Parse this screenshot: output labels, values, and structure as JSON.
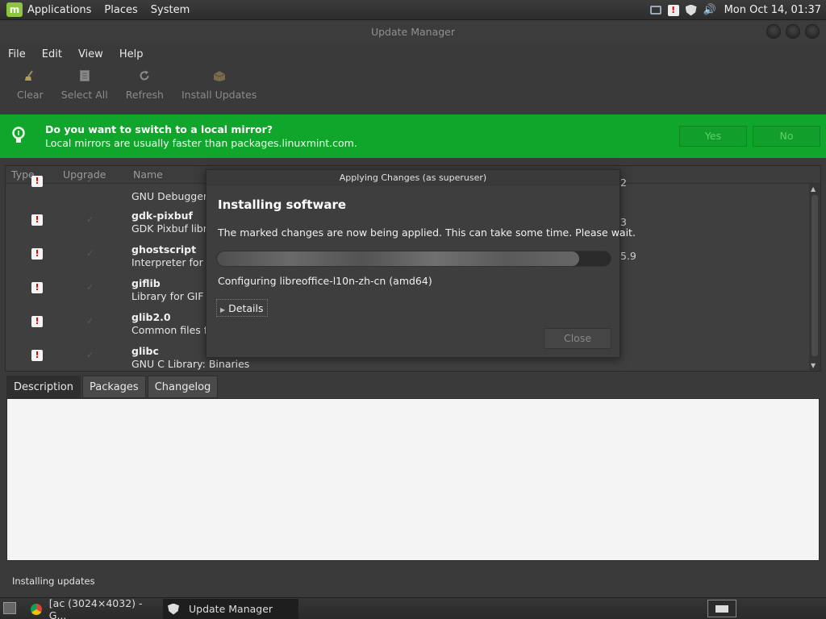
{
  "top_panel": {
    "menus": [
      "Applications",
      "Places",
      "System"
    ],
    "clock": "Mon Oct 14, 01:37",
    "tray_icons": [
      "network-icon",
      "alert-icon",
      "shield-icon",
      "volume-icon"
    ]
  },
  "window": {
    "title": "Update Manager",
    "menu": [
      "File",
      "Edit",
      "View",
      "Help"
    ],
    "toolbar": [
      {
        "label": "Clear",
        "icon": "broom-icon"
      },
      {
        "label": "Select All",
        "icon": "document-icon"
      },
      {
        "label": "Refresh",
        "icon": "refresh-icon"
      },
      {
        "label": "Install Updates",
        "icon": "package-icon"
      }
    ]
  },
  "infobar": {
    "title": "Do you want to switch to a local mirror?",
    "subtitle": "Local mirrors are usually faster than packages.linuxmint.com.",
    "yes_label": "Yes",
    "no_label": "No",
    "color": "#10a62b"
  },
  "list": {
    "columns": [
      "Type",
      "Upgrade",
      "Name"
    ],
    "rows": [
      {
        "name": "",
        "desc": "GNU Debugger",
        "ver": "2"
      },
      {
        "name": "gdk-pixbuf",
        "desc": "GDK Pixbuf libr",
        "ver": "3"
      },
      {
        "name": "ghostscript",
        "desc": "Interpreter for",
        "ver": "5.9"
      },
      {
        "name": "giflib",
        "desc": "Library for GIF i",
        "ver": ""
      },
      {
        "name": "glib2.0",
        "desc": "Common files f",
        "ver": ""
      },
      {
        "name": "glibc",
        "desc": "GNU C Library: Binaries",
        "ver": ""
      }
    ]
  },
  "tabs": [
    "Description",
    "Packages",
    "Changelog"
  ],
  "status_text": "Installing updates",
  "dialog": {
    "title": "Applying Changes (as superuser)",
    "heading": "Installing software",
    "message": "The marked changes are now being applied. This can take some time. Please wait.",
    "progress": 0.92,
    "status": "Configuring libreoffice-l10n-zh-cn (amd64)",
    "details_label": "Details",
    "close_label": "Close"
  },
  "taskbar": {
    "items": [
      {
        "label": "[ac (3024×4032) - G...",
        "icon": "chrome-icon"
      },
      {
        "label": "Update Manager",
        "icon": "shield-icon"
      }
    ]
  }
}
